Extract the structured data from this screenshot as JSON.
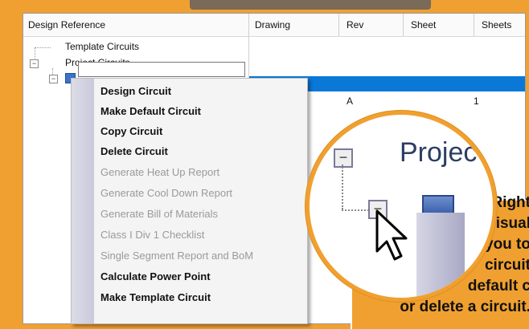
{
  "header": {
    "design_reference": "Design Reference",
    "drawing": "Drawing",
    "rev": "Rev",
    "sheet": "Sheet",
    "sheets": "Sheets"
  },
  "tree": {
    "template_circuits": "Template Circuits",
    "project_circuits": "Project Circuits"
  },
  "row": {
    "rev": "A",
    "sheet": "1"
  },
  "context_menu": {
    "items": [
      {
        "label": "Design Circuit",
        "enabled": true
      },
      {
        "label": "Make Default Circuit",
        "enabled": true
      },
      {
        "label": "Copy Circuit",
        "enabled": true
      },
      {
        "label": "Delete Circuit",
        "enabled": true
      },
      {
        "label": "Generate Heat Up Report",
        "enabled": false
      },
      {
        "label": "Generate Cool Down Report",
        "enabled": false
      },
      {
        "label": "Generate Bill of Materials",
        "enabled": false
      },
      {
        "label": "Class I Div 1 Checklist",
        "enabled": false
      },
      {
        "label": "Single Segment Report and BoM",
        "enabled": false
      },
      {
        "label": "Calculate Power Point",
        "enabled": true
      },
      {
        "label": "Make Template Circuit",
        "enabled": true
      }
    ]
  },
  "magnifier": {
    "text": "Projec"
  },
  "callout": {
    "lines": [
      "Right",
      "visual",
      "you to",
      "circuit",
      "default c",
      "or delete a circuit."
    ]
  },
  "colors": {
    "accent_orange": "#f0a030",
    "selection_blue": "#0a78d7",
    "disabled_text": "#9a9a9a"
  },
  "icons": [
    "tree-expander-icon",
    "circuit-node-icon",
    "mouse-pointer-icon"
  ]
}
